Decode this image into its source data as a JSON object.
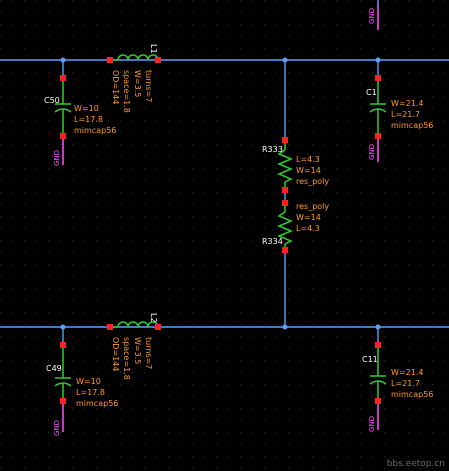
{
  "colors": {
    "background": "#000000",
    "grid": "#2a2a2a",
    "wire": "#5aa0ff",
    "pin": "#ff2020",
    "component": "#33cc33",
    "text": "#ff9a2a",
    "instance": "#ffffff",
    "ground": "#ff55ff"
  },
  "net_labels": {
    "gnd": "GND"
  },
  "inductors": {
    "l1": {
      "name": "L1",
      "params": [
        "OD=144",
        "space=1.8",
        "W=3.5",
        "turns=7"
      ]
    },
    "l2": {
      "name": "L2",
      "params": [
        "OD=144",
        "space=1.8",
        "W=3.5",
        "turns=7"
      ]
    }
  },
  "capacitors": {
    "c50": {
      "name": "C50",
      "params": [
        "W=10",
        "L=17.8",
        "mimcap56"
      ]
    },
    "c1": {
      "name": "C1",
      "params": [
        "W=21.4",
        "L=21.7",
        "mimcap56"
      ]
    },
    "c49": {
      "name": "C49",
      "params": [
        "W=10",
        "L=17.8",
        "mimcap56"
      ]
    },
    "c11": {
      "name": "C11",
      "params": [
        "W=21.4",
        "L=21.7",
        "mimcap56"
      ]
    }
  },
  "resistors": {
    "r333": {
      "name": "R333",
      "params": [
        "L=4.3",
        "W=14",
        "res_poly"
      ]
    },
    "r334": {
      "name": "R334",
      "params": [
        "res_poly",
        "W=14",
        "L=4.3"
      ]
    }
  },
  "watermark": "bbs.eetop.cn"
}
